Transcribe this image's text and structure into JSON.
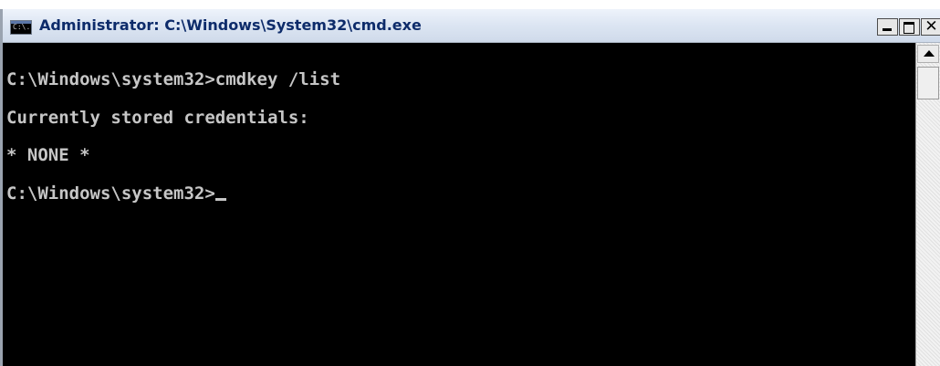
{
  "window": {
    "title": "Administrator: C:\\Windows\\System32\\cmd.exe",
    "icon_text": "C:\\."
  },
  "console": {
    "lines": [
      "C:\\Windows\\system32>cmdkey /list",
      "Currently stored credentials:",
      "* NONE *",
      "C:\\Windows\\system32>"
    ]
  },
  "colors": {
    "console_bg": "#000000",
    "console_text": "#c6c6c6",
    "title_text": "#0d2b6a"
  }
}
